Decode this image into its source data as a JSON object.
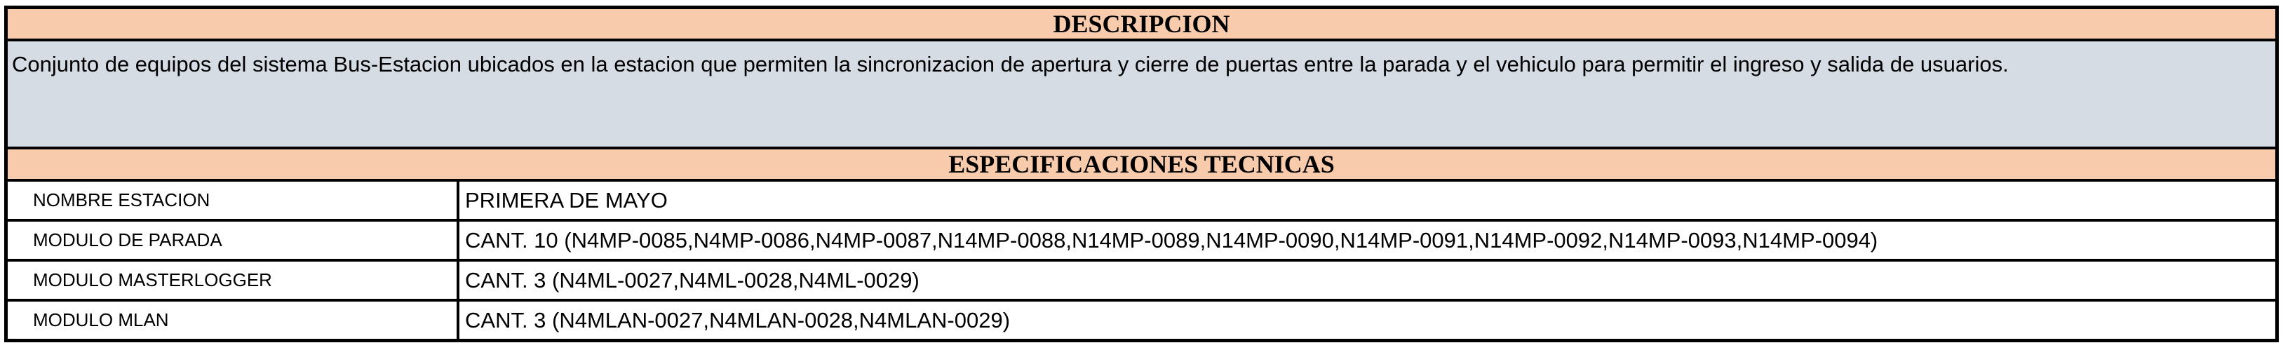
{
  "description": {
    "header": "DESCRIPCION",
    "text": "Conjunto de equipos del sistema Bus-Estacion ubicados en la estacion que permiten la sincronizacion de apertura y cierre de puertas entre la parada y el vehiculo para permitir el ingreso y salida de usuarios."
  },
  "specs": {
    "header": "ESPECIFICACIONES TECNICAS",
    "rows": [
      {
        "label": "NOMBRE ESTACION",
        "value": "PRIMERA DE MAYO"
      },
      {
        "label": "MODULO DE PARADA",
        "value": "CANT. 10 (N4MP-0085,N4MP-0086,N4MP-0087,N14MP-0088,N14MP-0089,N14MP-0090,N14MP-0091,N14MP-0092,N14MP-0093,N14MP-0094)"
      },
      {
        "label": "MODULO MASTERLOGGER",
        "value": "CANT. 3 (N4ML-0027,N4ML-0028,N4ML-0029)"
      },
      {
        "label": "MODULO MLAN",
        "value": "CANT. 3 (N4MLAN-0027,N4MLAN-0028,N4MLAN-0029)"
      }
    ]
  }
}
